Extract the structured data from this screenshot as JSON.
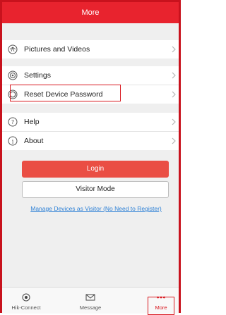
{
  "header": {
    "title": "More"
  },
  "menu": {
    "pictures_label": "Pictures and Videos",
    "settings_label": "Settings",
    "reset_label": "Reset Device Password",
    "help_label": "Help",
    "about_label": "About"
  },
  "actions": {
    "login_label": "Login",
    "visitor_label": "Visitor Mode",
    "visitor_link": "Manage Devices as Visitor (No Need to Register)"
  },
  "tabs": [
    {
      "label": "Hik-Connect",
      "icon": "camera-icon"
    },
    {
      "label": "Message",
      "icon": "envelope-icon"
    },
    {
      "label": "More",
      "icon": "more-dots-icon"
    }
  ],
  "colors": {
    "header": "#e8232e",
    "accent": "#d8181f",
    "login": "#ea4e44",
    "link": "#2d80d6"
  }
}
